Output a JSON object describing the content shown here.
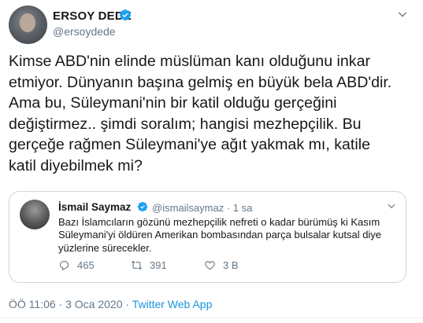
{
  "tweet": {
    "author_name": "ERSOY DEDE",
    "author_handle": "@ersoydede",
    "text": "Kimse ABD'nin elinde müslüman kanı olduğunu inkar\netmiyor. Dünyanın başına gelmiş en büyük bela ABD'dir.\nAma bu, Süleymani'nin bir katil olduğu gerçeğini\ndeğiştirmez.. şimdi soralım; hangisi mezhepçilik. Bu\ngerçeğe rağmen Süleymani'ye ağıt yakmak mı, katile\nkatil diyebilmek mi?",
    "timestamp": "ÖÖ 11:06 · 3 Oca 2020 · ",
    "source_app": "Twitter Web App"
  },
  "quote": {
    "author_name": "İsmail Saymaz",
    "author_handle": "@ismailsaymaz",
    "time_ago": " · 1 sa",
    "text": "Bazı İslamcıların gözünü mezhepçilik nefreti o kadar bürümüş ki Kasım Süleymani'yi öldüren Amerikan bombasından parça bulsalar kutsal diye yüzlerine sürecekler.",
    "replies": "465",
    "retweets": "391",
    "likes": "3 B"
  },
  "colors": {
    "verified": "#1da1f2",
    "link": "#1b95e0",
    "muted": "#657786"
  },
  "icons": {
    "verified": "verified-badge-icon",
    "menu": "chevron-down-icon",
    "reply": "reply-icon",
    "retweet": "retweet-icon",
    "like": "heart-icon"
  }
}
